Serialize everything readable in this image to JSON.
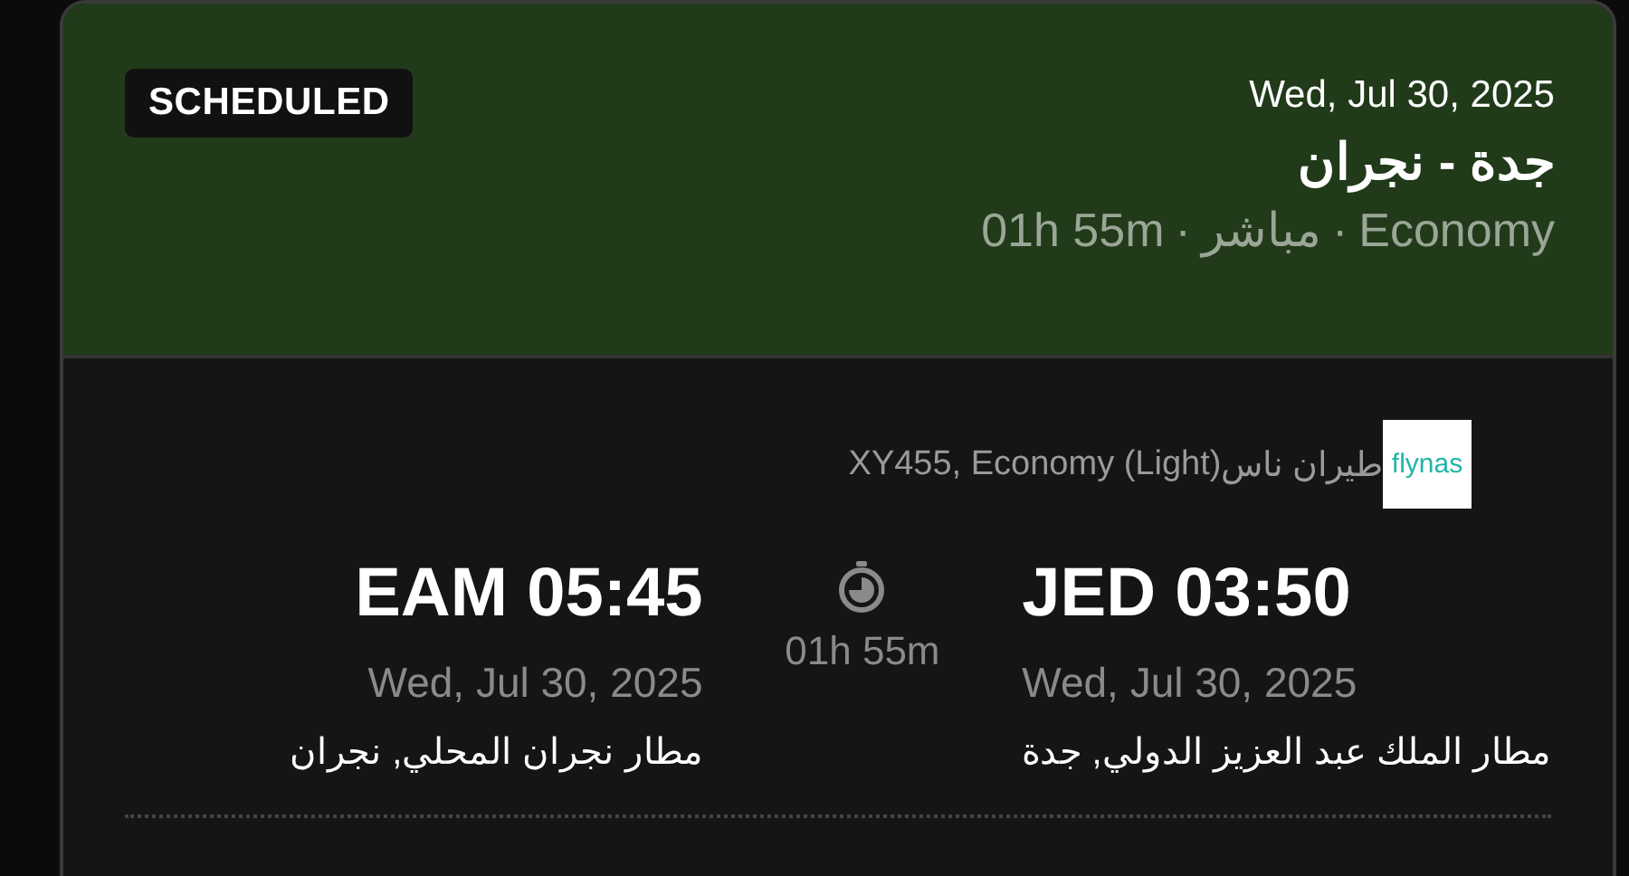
{
  "header": {
    "status": "SCHEDULED",
    "date": "Wed, Jul 30, 2025",
    "route": "جدة - نجران",
    "meta_parts": [
      "Economy",
      "مباشر",
      "01h 55m"
    ],
    "separator": "·"
  },
  "airline": {
    "logo_text": "flynas",
    "name": "طيران ناس",
    "fare": "XY455, Economy (Light)"
  },
  "departure": {
    "time": "JED 03:50",
    "date": "Wed, Jul 30, 2025",
    "airport": "مطار الملك عبد العزيز الدولي, جدة"
  },
  "duration": "01h 55m",
  "arrival": {
    "time": "EAM 05:45",
    "date": "Wed, Jul 30, 2025",
    "airport": "مطار نجران المحلي, نجران"
  }
}
